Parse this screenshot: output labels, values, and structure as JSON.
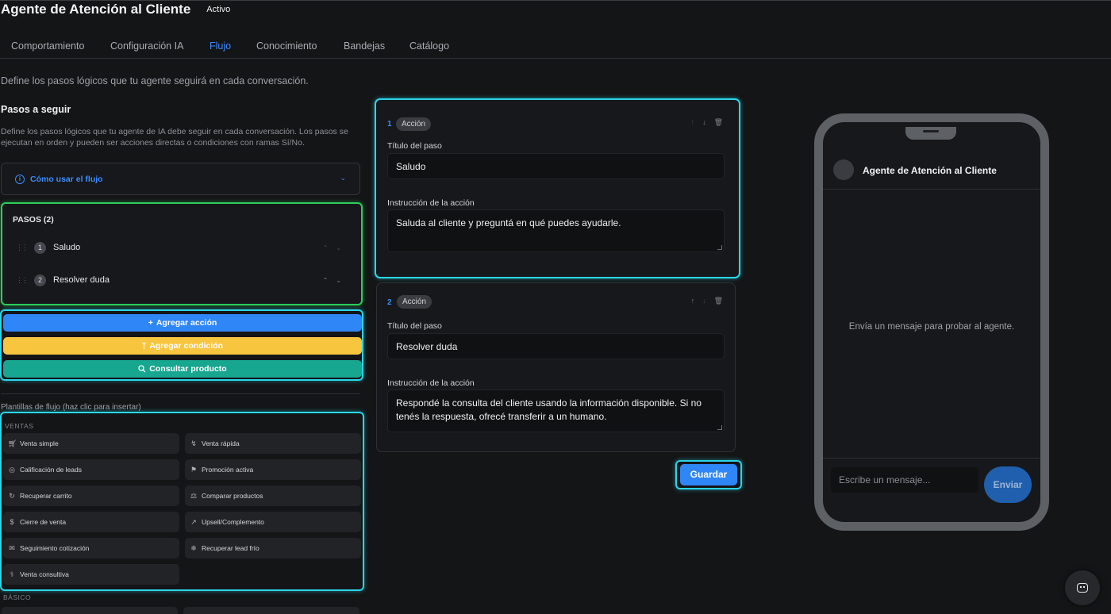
{
  "header": {
    "title": "Agente de Atención al Cliente",
    "status": "Activo"
  },
  "tabs": [
    {
      "label": "Comportamiento"
    },
    {
      "label": "Configuración IA"
    },
    {
      "label": "Flujo"
    },
    {
      "label": "Conocimiento"
    },
    {
      "label": "Bandejas"
    },
    {
      "label": "Catálogo"
    }
  ],
  "active_tab": "Flujo",
  "main": {
    "description": "Define los pasos lógicos que tu agente seguirá en cada conversación."
  },
  "steps_section": {
    "title": "Pasos a seguir",
    "description": "Define los pasos lógicos que tu agente de IA debe seguir en cada conversación. Los pasos se ejecutan en orden y pueden ser acciones directas o condiciones con ramas Sí/No.",
    "howto_label": "Cómo usar el flujo",
    "list_header": "PASOS (2)",
    "steps": [
      {
        "number": "1",
        "name": "Saludo"
      },
      {
        "number": "2",
        "name": "Resolver duda"
      }
    ]
  },
  "actions": {
    "add_action": "Agregar acción",
    "add_condition": "Agregar condición",
    "check_product": "Consultar producto"
  },
  "templates": {
    "title": "Plantillas de flujo (haz clic para insertar)",
    "category_sales": "VENTAS",
    "category_basic": "BÁSICO",
    "items": [
      {
        "label": "Venta simple",
        "icon": "cart-icon"
      },
      {
        "label": "Venta rápida",
        "icon": "zap-icon"
      },
      {
        "label": "Calificación de leads",
        "icon": "target-icon"
      },
      {
        "label": "Promoción activa",
        "icon": "megaphone-icon"
      },
      {
        "label": "Recuperar carrito",
        "icon": "refresh-icon"
      },
      {
        "label": "Comparar productos",
        "icon": "scale-icon"
      },
      {
        "label": "Cierre de venta",
        "icon": "dollar-icon"
      },
      {
        "label": "Upsell/Complemento",
        "icon": "trending-up-icon"
      },
      {
        "label": "Seguimiento cotización",
        "icon": "mail-icon"
      },
      {
        "label": "Recuperar lead frío",
        "icon": "snowflake-icon"
      },
      {
        "label": "Venta consultiva",
        "icon": "stethoscope-icon"
      }
    ]
  },
  "cards": [
    {
      "number": "1",
      "type": "Acción",
      "title_label": "Título del paso",
      "title_value": "Saludo",
      "instruction_label": "Instrucción de la acción",
      "instruction_value": "Saluda al cliente y preguntá en qué puedes ayudarle."
    },
    {
      "number": "2",
      "type": "Acción",
      "title_label": "Título del paso",
      "title_value": "Resolver duda",
      "instruction_label": "Instrucción de la acción",
      "instruction_value": "Respondé la consulta del cliente usando la información disponible. Si no tenés la respuesta, ofrecé transferir a un humano."
    }
  ],
  "save_label": "Guardar",
  "preview": {
    "agent_name": "Agente de Atención al Cliente",
    "empty_message": "Envía un mensaje para probar al agente.",
    "input_placeholder": "Escribe un mensaje...",
    "send_label": "Enviar"
  },
  "colors": {
    "accent": "#3b8cff",
    "action_blue": "#2f86f6",
    "condition_yellow": "#f8c53e",
    "product_teal": "#17a68f",
    "highlight_cyan": "#2ad6e8",
    "highlight_green": "#2ecc5a"
  }
}
